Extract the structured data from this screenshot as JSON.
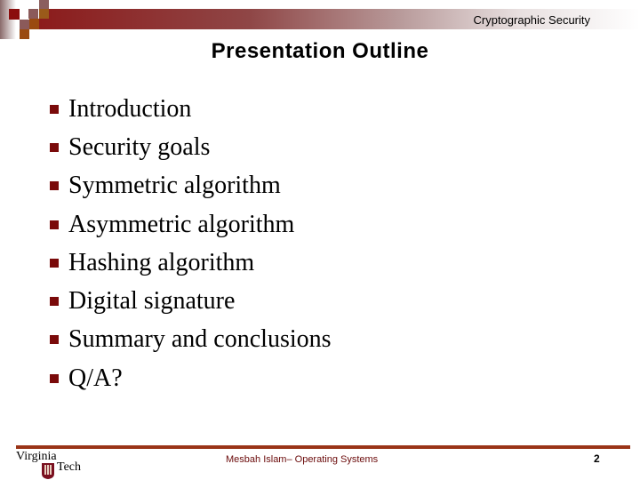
{
  "header": {
    "label": "Cryptographic Security"
  },
  "slide": {
    "title": "Presentation Outline",
    "bullets": [
      "Introduction",
      "Security goals",
      "Symmetric algorithm",
      "Asymmetric algorithm",
      "Hashing algorithm",
      "Digital signature",
      "Summary and conclusions",
      "Q/A?"
    ]
  },
  "footer": {
    "logo": {
      "line1": "Virginia",
      "line2": "Tech"
    },
    "center_text": "Mesbah Islam– Operating Systems",
    "page_number": "2"
  },
  "colors": {
    "accent": "#8c1c1c",
    "footer_line": "#9a3418",
    "bullet": "#7a0a0a"
  }
}
